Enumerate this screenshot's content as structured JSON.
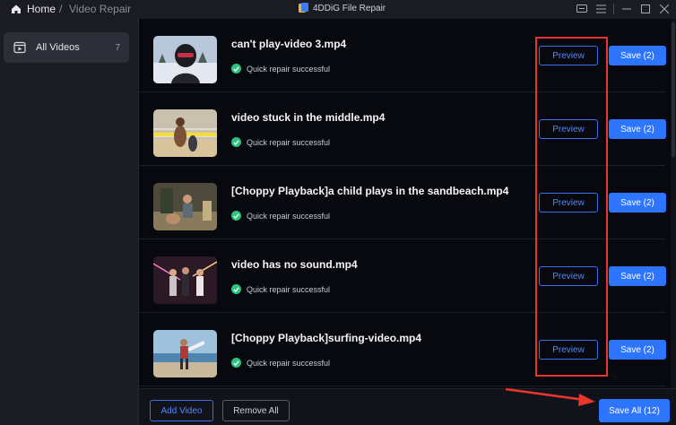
{
  "titlebar": {
    "home_label": "Home",
    "separator": "/",
    "page_label": "Video Repair",
    "app_title": "4DDiG File Repair"
  },
  "sidebar": {
    "items": [
      {
        "label": "All Videos",
        "count": "7"
      }
    ]
  },
  "videos": [
    {
      "title": "can't play-video 3.mp4",
      "status": "Quick repair successful",
      "preview_label": "Preview",
      "save_label": "Save (2)"
    },
    {
      "title": "video stuck in the middle.mp4",
      "status": "Quick repair successful",
      "preview_label": "Preview",
      "save_label": "Save (2)"
    },
    {
      "title": "[Choppy Playback]a child plays in the sandbeach.mp4",
      "status": "Quick repair successful",
      "preview_label": "Preview",
      "save_label": "Save (2)"
    },
    {
      "title": "video has no sound.mp4",
      "status": "Quick repair successful",
      "preview_label": "Preview",
      "save_label": "Save (2)"
    },
    {
      "title": "[Choppy Playback]surfing-video.mp4",
      "status": "Quick repair successful",
      "preview_label": "Preview",
      "save_label": "Save (2)"
    }
  ],
  "bottom": {
    "add_label": "Add Video",
    "remove_label": "Remove All",
    "save_all_label": "Save All (12)"
  },
  "colors": {
    "accent": "#2d74ff",
    "success": "#2ec27e",
    "annotation": "#e8362c"
  }
}
